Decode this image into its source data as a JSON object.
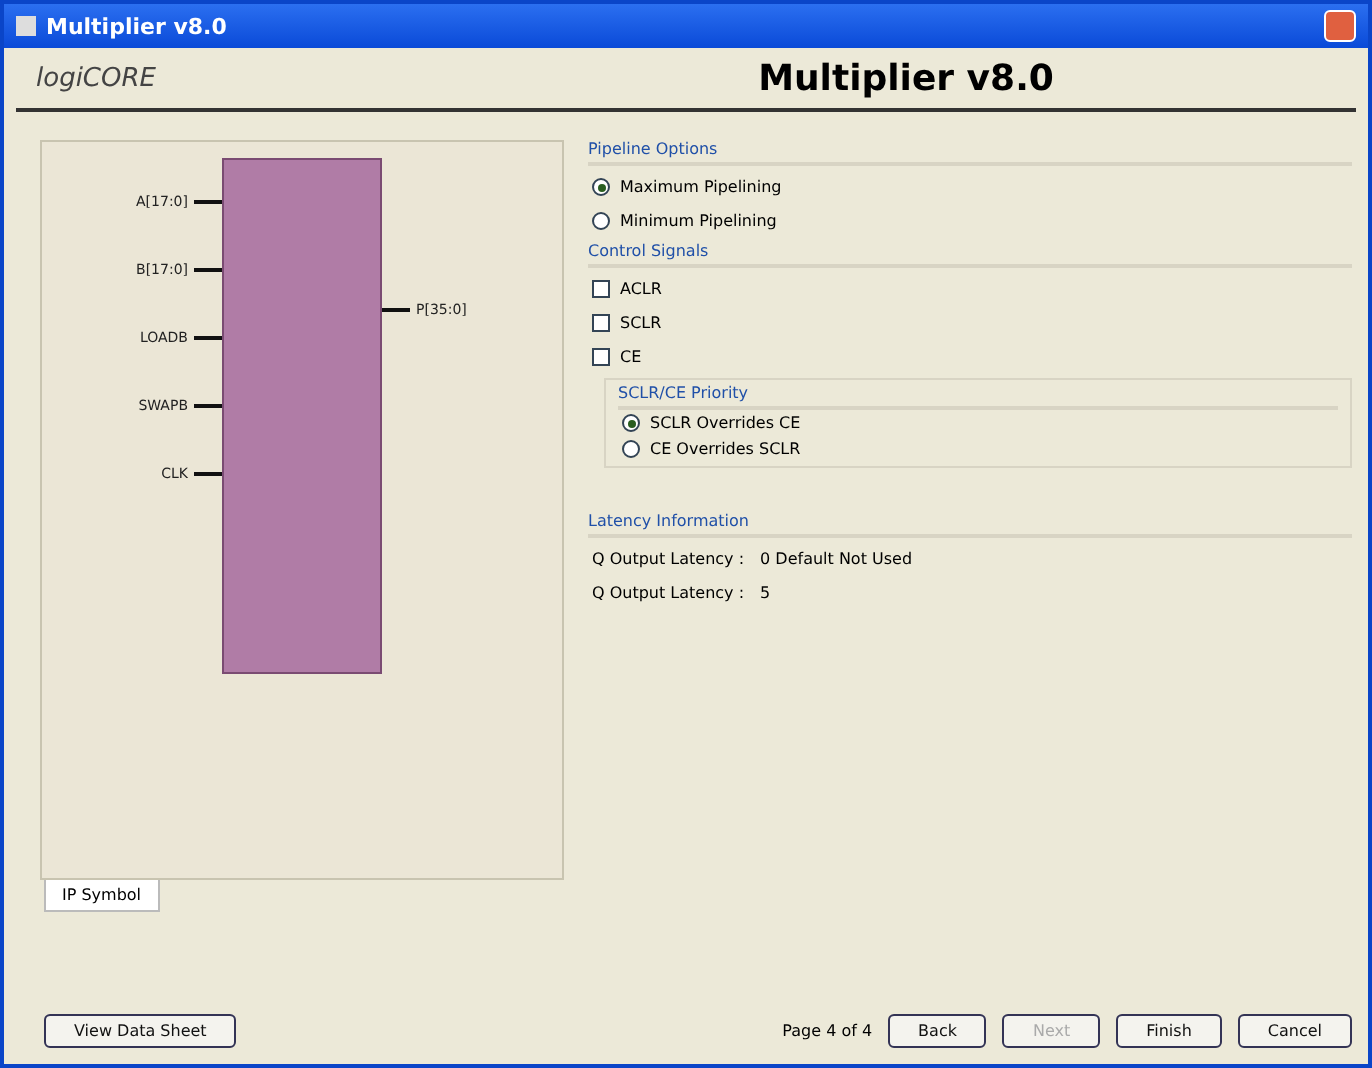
{
  "window": {
    "title": "Multiplier v8.0"
  },
  "header": {
    "logo": "logiCORE",
    "title": "Multiplier v8.0"
  },
  "symbol": {
    "left_pins": [
      {
        "name": "A[17:0]",
        "active": true
      },
      {
        "name": "B[17:0]",
        "active": true
      },
      {
        "name": "LOADB",
        "active": true
      },
      {
        "name": "SWAPB",
        "active": true
      },
      {
        "name": "CLK",
        "active": true
      }
    ],
    "right_pins": [
      {
        "name": "P[35:0]",
        "active": true
      }
    ]
  },
  "symbol_tabs": [
    {
      "label": "IP Symbol",
      "selected": true
    }
  ],
  "pipeline": {
    "title": "Pipeline Options",
    "options": [
      {
        "label": "Maximum Pipelining",
        "selected": true
      },
      {
        "label": "Minimum Pipelining",
        "selected": false
      }
    ]
  },
  "control": {
    "title": "Control Signals",
    "signals": [
      {
        "label": "ACLR",
        "checked": false
      },
      {
        "label": "SCLR",
        "checked": false
      },
      {
        "label": "CE",
        "checked": false
      }
    ],
    "priority": {
      "title": "SCLR/CE Priority",
      "options": [
        {
          "label": "SCLR Overrides CE",
          "selected": true
        },
        {
          "label": "CE Overrides SCLR",
          "selected": false
        }
      ]
    }
  },
  "latency": {
    "title": "Latency Information",
    "rows": [
      {
        "label": "Q Output Latency :",
        "value": "0 Default Not Used"
      },
      {
        "label": "Q Output Latency :",
        "value": "5"
      }
    ]
  },
  "footer": {
    "datasheet": "View Data Sheet",
    "page": "Page 4 of 4",
    "buttons": [
      {
        "label": "Back",
        "disabled": false
      },
      {
        "label": "Next",
        "disabled": true
      },
      {
        "label": "Finish",
        "disabled": false
      },
      {
        "label": "Cancel",
        "disabled": false
      }
    ]
  }
}
